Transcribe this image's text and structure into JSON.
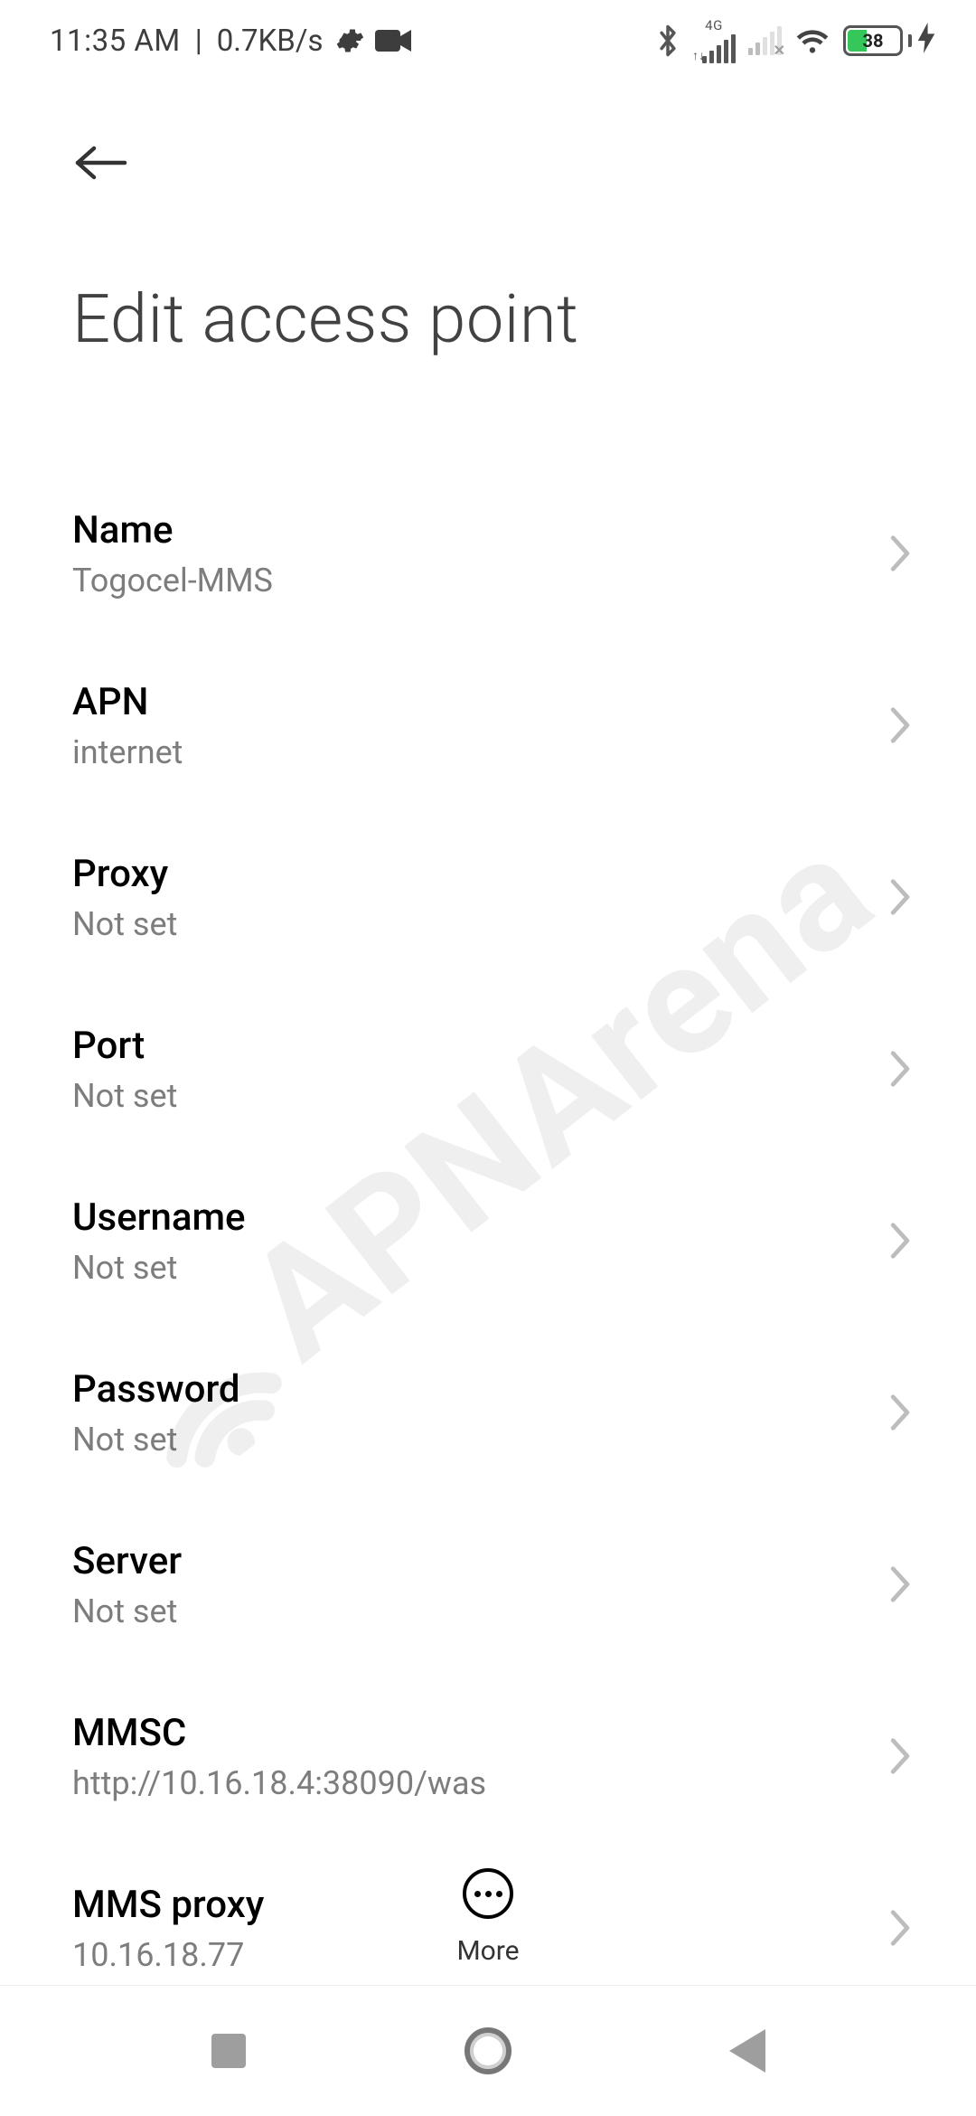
{
  "status_bar": {
    "time": "11:35 AM",
    "data_rate": "0.7KB/s",
    "signal1_tech": "4G",
    "battery_percent": "38"
  },
  "header": {
    "title": "Edit access point"
  },
  "apn_fields": [
    {
      "label": "Name",
      "value": "Togocel-MMS"
    },
    {
      "label": "APN",
      "value": "internet"
    },
    {
      "label": "Proxy",
      "value": "Not set"
    },
    {
      "label": "Port",
      "value": "Not set"
    },
    {
      "label": "Username",
      "value": "Not set"
    },
    {
      "label": "Password",
      "value": "Not set"
    },
    {
      "label": "Server",
      "value": "Not set"
    },
    {
      "label": "MMSC",
      "value": "http://10.16.18.4:38090/was"
    },
    {
      "label": "MMS proxy",
      "value": "10.16.18.77"
    }
  ],
  "bottom_action": {
    "more_label": "More"
  },
  "watermark_text": "APNArena"
}
